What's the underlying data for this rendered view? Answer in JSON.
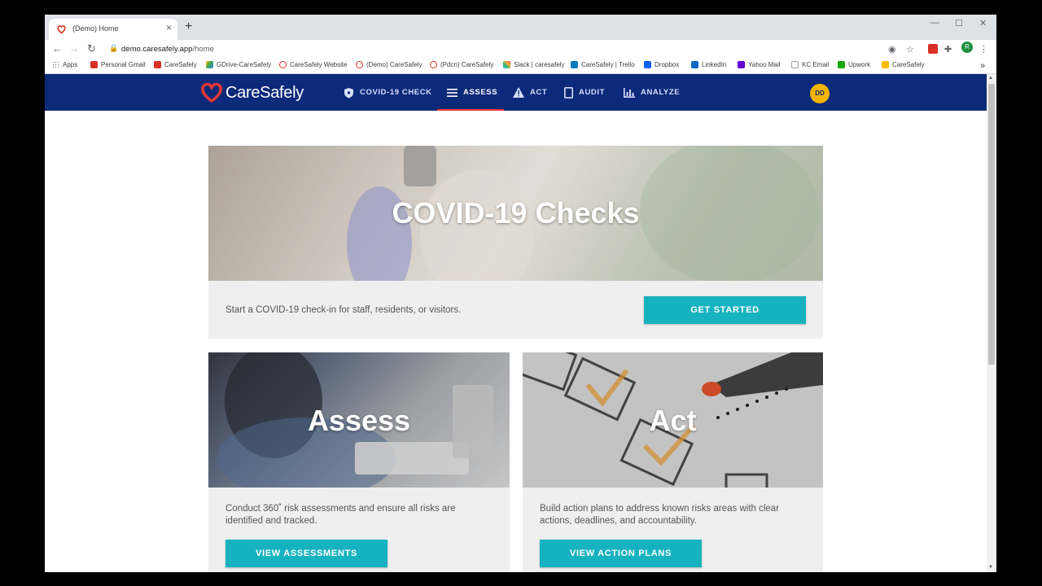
{
  "browser": {
    "tab_title": "(Demo) Home",
    "url_host": "demo.caresafely.app",
    "url_path": "/home",
    "profile_initial": "R",
    "bookmarks": [
      {
        "label": "Apps",
        "color": "#5f6368"
      },
      {
        "label": "Personal Gmail",
        "color": "#d93025"
      },
      {
        "label": "CareSafely",
        "color": "#d93025"
      },
      {
        "label": "GDrive-CareSafely",
        "color": "#34a853"
      },
      {
        "label": "CareSafely Website",
        "color": "#d93025"
      },
      {
        "label": "(Demo) CareSafely",
        "color": "#d93025"
      },
      {
        "label": "(Pdcn) CareSafely",
        "color": "#d93025"
      },
      {
        "label": "Slack | caresafely",
        "color": "#611f69"
      },
      {
        "label": "CareSafely | Trello",
        "color": "#0079bf"
      },
      {
        "label": "Dropbox",
        "color": "#0061ff"
      },
      {
        "label": "LinkedIn",
        "color": "#0a66c2"
      },
      {
        "label": "Yahoo Mail",
        "color": "#6001d2"
      },
      {
        "label": "KC Email",
        "color": "#9aa0a6"
      },
      {
        "label": "Upwork",
        "color": "#14a800"
      },
      {
        "label": "CareSafely",
        "color": "#fbbc04"
      }
    ]
  },
  "app": {
    "brand": "CareSafely",
    "accent": "#e53935",
    "nav_bg": "#0d2a7a",
    "nav": [
      {
        "label": "COVID-19 CHECK",
        "icon": "shield-icon"
      },
      {
        "label": "ASSESS",
        "icon": "list-icon",
        "active": true
      },
      {
        "label": "ACT",
        "icon": "warning-icon"
      },
      {
        "label": "AUDIT",
        "icon": "tablet-icon"
      },
      {
        "label": "ANALYZE",
        "icon": "bar-chart-icon"
      }
    ],
    "user_initials": "DD"
  },
  "cards": {
    "covid": {
      "title": "COVID-19 Checks",
      "description": "Start a COVID-19 check-in for staff, residents, or visitors.",
      "button": "GET STARTED"
    },
    "assess": {
      "title": "Assess",
      "description": "Conduct 360˚ risk assessments and ensure all risks are identified and tracked.",
      "button": "VIEW ASSESSMENTS"
    },
    "act": {
      "title": "Act",
      "description": "Build action plans to address known risks areas with clear actions, deadlines, and accountability.",
      "button": "VIEW ACTION PLANS"
    }
  },
  "colors": {
    "button": "#17b2bf",
    "avatar": "#f4b400"
  }
}
